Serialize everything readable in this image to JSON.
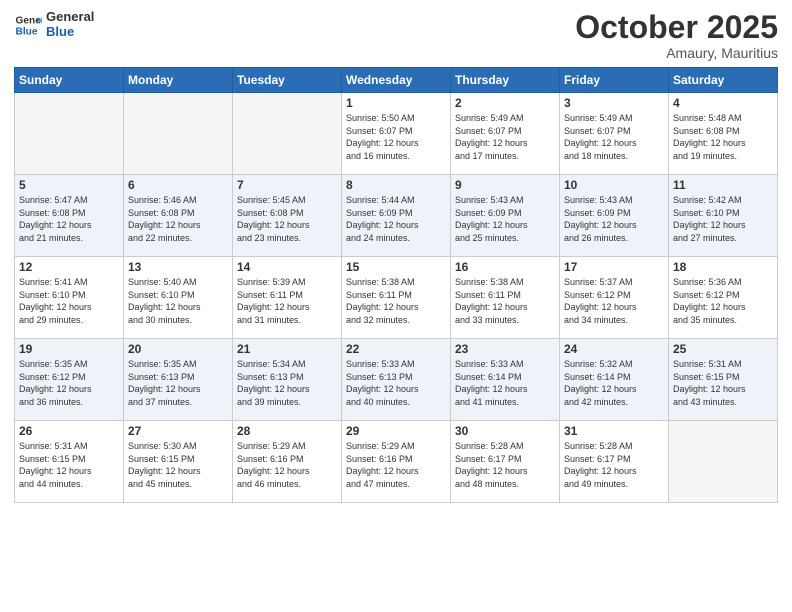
{
  "header": {
    "logo_general": "General",
    "logo_blue": "Blue",
    "month": "October 2025",
    "location": "Amaury, Mauritius"
  },
  "weekdays": [
    "Sunday",
    "Monday",
    "Tuesday",
    "Wednesday",
    "Thursday",
    "Friday",
    "Saturday"
  ],
  "weeks": [
    [
      {
        "day": "",
        "info": ""
      },
      {
        "day": "",
        "info": ""
      },
      {
        "day": "",
        "info": ""
      },
      {
        "day": "1",
        "info": "Sunrise: 5:50 AM\nSunset: 6:07 PM\nDaylight: 12 hours\nand 16 minutes."
      },
      {
        "day": "2",
        "info": "Sunrise: 5:49 AM\nSunset: 6:07 PM\nDaylight: 12 hours\nand 17 minutes."
      },
      {
        "day": "3",
        "info": "Sunrise: 5:49 AM\nSunset: 6:07 PM\nDaylight: 12 hours\nand 18 minutes."
      },
      {
        "day": "4",
        "info": "Sunrise: 5:48 AM\nSunset: 6:08 PM\nDaylight: 12 hours\nand 19 minutes."
      }
    ],
    [
      {
        "day": "5",
        "info": "Sunrise: 5:47 AM\nSunset: 6:08 PM\nDaylight: 12 hours\nand 21 minutes."
      },
      {
        "day": "6",
        "info": "Sunrise: 5:46 AM\nSunset: 6:08 PM\nDaylight: 12 hours\nand 22 minutes."
      },
      {
        "day": "7",
        "info": "Sunrise: 5:45 AM\nSunset: 6:08 PM\nDaylight: 12 hours\nand 23 minutes."
      },
      {
        "day": "8",
        "info": "Sunrise: 5:44 AM\nSunset: 6:09 PM\nDaylight: 12 hours\nand 24 minutes."
      },
      {
        "day": "9",
        "info": "Sunrise: 5:43 AM\nSunset: 6:09 PM\nDaylight: 12 hours\nand 25 minutes."
      },
      {
        "day": "10",
        "info": "Sunrise: 5:43 AM\nSunset: 6:09 PM\nDaylight: 12 hours\nand 26 minutes."
      },
      {
        "day": "11",
        "info": "Sunrise: 5:42 AM\nSunset: 6:10 PM\nDaylight: 12 hours\nand 27 minutes."
      }
    ],
    [
      {
        "day": "12",
        "info": "Sunrise: 5:41 AM\nSunset: 6:10 PM\nDaylight: 12 hours\nand 29 minutes."
      },
      {
        "day": "13",
        "info": "Sunrise: 5:40 AM\nSunset: 6:10 PM\nDaylight: 12 hours\nand 30 minutes."
      },
      {
        "day": "14",
        "info": "Sunrise: 5:39 AM\nSunset: 6:11 PM\nDaylight: 12 hours\nand 31 minutes."
      },
      {
        "day": "15",
        "info": "Sunrise: 5:38 AM\nSunset: 6:11 PM\nDaylight: 12 hours\nand 32 minutes."
      },
      {
        "day": "16",
        "info": "Sunrise: 5:38 AM\nSunset: 6:11 PM\nDaylight: 12 hours\nand 33 minutes."
      },
      {
        "day": "17",
        "info": "Sunrise: 5:37 AM\nSunset: 6:12 PM\nDaylight: 12 hours\nand 34 minutes."
      },
      {
        "day": "18",
        "info": "Sunrise: 5:36 AM\nSunset: 6:12 PM\nDaylight: 12 hours\nand 35 minutes."
      }
    ],
    [
      {
        "day": "19",
        "info": "Sunrise: 5:35 AM\nSunset: 6:12 PM\nDaylight: 12 hours\nand 36 minutes."
      },
      {
        "day": "20",
        "info": "Sunrise: 5:35 AM\nSunset: 6:13 PM\nDaylight: 12 hours\nand 37 minutes."
      },
      {
        "day": "21",
        "info": "Sunrise: 5:34 AM\nSunset: 6:13 PM\nDaylight: 12 hours\nand 39 minutes."
      },
      {
        "day": "22",
        "info": "Sunrise: 5:33 AM\nSunset: 6:13 PM\nDaylight: 12 hours\nand 40 minutes."
      },
      {
        "day": "23",
        "info": "Sunrise: 5:33 AM\nSunset: 6:14 PM\nDaylight: 12 hours\nand 41 minutes."
      },
      {
        "day": "24",
        "info": "Sunrise: 5:32 AM\nSunset: 6:14 PM\nDaylight: 12 hours\nand 42 minutes."
      },
      {
        "day": "25",
        "info": "Sunrise: 5:31 AM\nSunset: 6:15 PM\nDaylight: 12 hours\nand 43 minutes."
      }
    ],
    [
      {
        "day": "26",
        "info": "Sunrise: 5:31 AM\nSunset: 6:15 PM\nDaylight: 12 hours\nand 44 minutes."
      },
      {
        "day": "27",
        "info": "Sunrise: 5:30 AM\nSunset: 6:15 PM\nDaylight: 12 hours\nand 45 minutes."
      },
      {
        "day": "28",
        "info": "Sunrise: 5:29 AM\nSunset: 6:16 PM\nDaylight: 12 hours\nand 46 minutes."
      },
      {
        "day": "29",
        "info": "Sunrise: 5:29 AM\nSunset: 6:16 PM\nDaylight: 12 hours\nand 47 minutes."
      },
      {
        "day": "30",
        "info": "Sunrise: 5:28 AM\nSunset: 6:17 PM\nDaylight: 12 hours\nand 48 minutes."
      },
      {
        "day": "31",
        "info": "Sunrise: 5:28 AM\nSunset: 6:17 PM\nDaylight: 12 hours\nand 49 minutes."
      },
      {
        "day": "",
        "info": ""
      }
    ]
  ]
}
